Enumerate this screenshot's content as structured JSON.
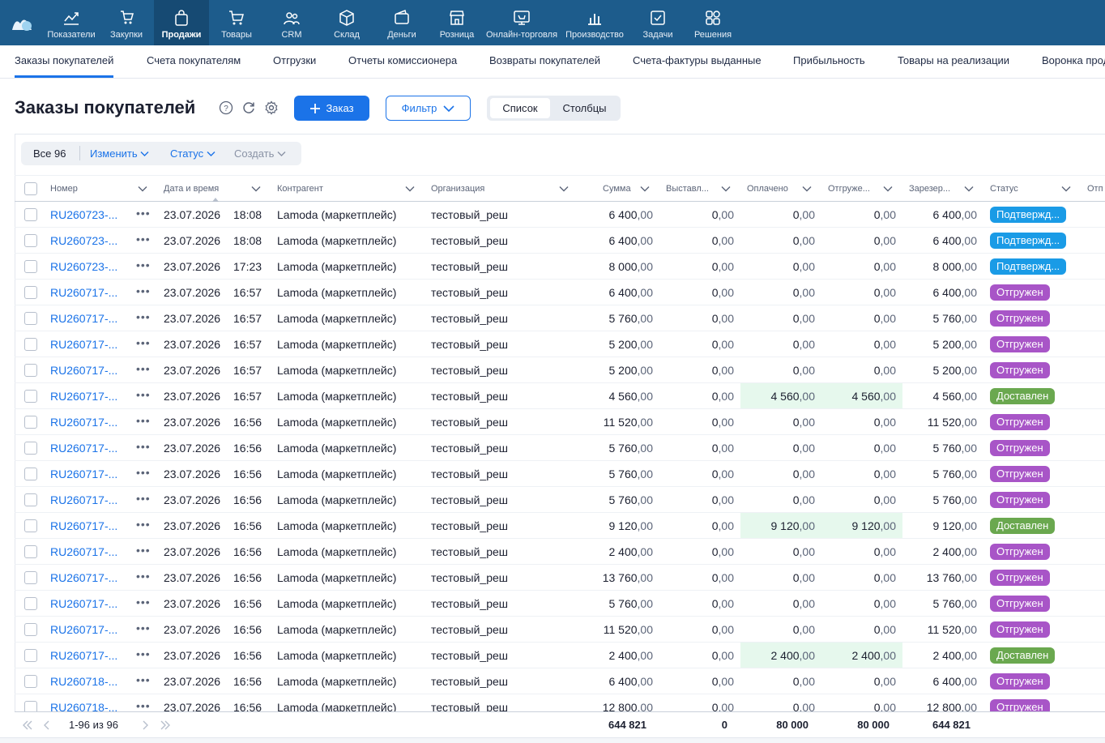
{
  "topnav": {
    "items": [
      {
        "label": "Показатели",
        "icon": "chart-line-icon"
      },
      {
        "label": "Закупки",
        "icon": "cart-hand-icon"
      },
      {
        "label": "Продажи",
        "icon": "shopping-bag-icon",
        "active": true
      },
      {
        "label": "Товары",
        "icon": "cart-icon"
      },
      {
        "label": "CRM",
        "icon": "users-icon"
      },
      {
        "label": "Склад",
        "icon": "box-icon"
      },
      {
        "label": "Деньги",
        "icon": "wallet-icon"
      },
      {
        "label": "Розница",
        "icon": "store-icon"
      },
      {
        "label": "Онлайн-торговля",
        "icon": "online-store-icon"
      },
      {
        "label": "Производство",
        "icon": "bar-chart-icon"
      },
      {
        "label": "Задачи",
        "icon": "check-icon"
      },
      {
        "label": "Решения",
        "icon": "grid-icon"
      }
    ]
  },
  "subnav": {
    "items": [
      "Заказы покупателей",
      "Счета покупателям",
      "Отгрузки",
      "Отчеты комиссионера",
      "Возвраты покупателей",
      "Счета-фактуры выданные",
      "Прибыльность",
      "Товары на реализации",
      "Воронка продаж"
    ]
  },
  "page": {
    "title": "Заказы покупателей",
    "add_button": "Заказ",
    "filter_button": "Фильтр",
    "view_list": "Список",
    "view_columns": "Столбцы"
  },
  "toolbar": {
    "all": "Все 96",
    "edit": "Изменить",
    "status": "Статус",
    "create": "Создать"
  },
  "table": {
    "headers": {
      "number": "Номер",
      "datetime": "Дата и время",
      "counterparty": "Контрагент",
      "organization": "Организация",
      "sum": "Сумма",
      "invoiced": "Выставл...",
      "paid": "Оплачено",
      "shipped": "Отгруже...",
      "reserved": "Зарезер...",
      "status": "Статус",
      "extra": "Отп"
    },
    "rows": [
      {
        "number": "RU260723-...",
        "date": "23.07.2026",
        "time": "18:08",
        "counterparty": "Lamoda (маркетплейс)",
        "org": "тестовый_реш",
        "sum": "6 400",
        "invoiced": "0",
        "paid": "0",
        "shipped": "0",
        "reserved": "6 400",
        "status": "Подтвержд...",
        "status_color": "#1a9be6",
        "highlight": false
      },
      {
        "number": "RU260723-...",
        "date": "23.07.2026",
        "time": "18:08",
        "counterparty": "Lamoda (маркетплейс)",
        "org": "тестовый_реш",
        "sum": "6 400",
        "invoiced": "0",
        "paid": "0",
        "shipped": "0",
        "reserved": "6 400",
        "status": "Подтвержд...",
        "status_color": "#1a9be6",
        "highlight": false
      },
      {
        "number": "RU260723-...",
        "date": "23.07.2026",
        "time": "17:23",
        "counterparty": "Lamoda (маркетплейс)",
        "org": "тестовый_реш",
        "sum": "8 000",
        "invoiced": "0",
        "paid": "0",
        "shipped": "0",
        "reserved": "8 000",
        "status": "Подтвержд...",
        "status_color": "#1a9be6",
        "highlight": false
      },
      {
        "number": "RU260717-...",
        "date": "23.07.2026",
        "time": "16:57",
        "counterparty": "Lamoda (маркетплейс)",
        "org": "тестовый_реш",
        "sum": "6 400",
        "invoiced": "0",
        "paid": "0",
        "shipped": "0",
        "reserved": "6 400",
        "status": "Отгружен",
        "status_color": "#a855c7",
        "highlight": false
      },
      {
        "number": "RU260717-...",
        "date": "23.07.2026",
        "time": "16:57",
        "counterparty": "Lamoda (маркетплейс)",
        "org": "тестовый_реш",
        "sum": "5 760",
        "invoiced": "0",
        "paid": "0",
        "shipped": "0",
        "reserved": "5 760",
        "status": "Отгружен",
        "status_color": "#a855c7",
        "highlight": false
      },
      {
        "number": "RU260717-...",
        "date": "23.07.2026",
        "time": "16:57",
        "counterparty": "Lamoda (маркетплейс)",
        "org": "тестовый_реш",
        "sum": "5 200",
        "invoiced": "0",
        "paid": "0",
        "shipped": "0",
        "reserved": "5 200",
        "status": "Отгружен",
        "status_color": "#a855c7",
        "highlight": false
      },
      {
        "number": "RU260717-...",
        "date": "23.07.2026",
        "time": "16:57",
        "counterparty": "Lamoda (маркетплейс)",
        "org": "тестовый_реш",
        "sum": "5 200",
        "invoiced": "0",
        "paid": "0",
        "shipped": "0",
        "reserved": "5 200",
        "status": "Отгружен",
        "status_color": "#a855c7",
        "highlight": false
      },
      {
        "number": "RU260717-...",
        "date": "23.07.2026",
        "time": "16:57",
        "counterparty": "Lamoda (маркетплейс)",
        "org": "тестовый_реш",
        "sum": "4 560",
        "invoiced": "0",
        "paid": "4 560",
        "shipped": "4 560",
        "reserved": "4 560",
        "status": "Доставлен",
        "status_color": "#6aa84f",
        "highlight": true
      },
      {
        "number": "RU260717-...",
        "date": "23.07.2026",
        "time": "16:56",
        "counterparty": "Lamoda (маркетплейс)",
        "org": "тестовый_реш",
        "sum": "11 520",
        "invoiced": "0",
        "paid": "0",
        "shipped": "0",
        "reserved": "11 520",
        "status": "Отгружен",
        "status_color": "#a855c7",
        "highlight": false
      },
      {
        "number": "RU260717-...",
        "date": "23.07.2026",
        "time": "16:56",
        "counterparty": "Lamoda (маркетплейс)",
        "org": "тестовый_реш",
        "sum": "5 760",
        "invoiced": "0",
        "paid": "0",
        "shipped": "0",
        "reserved": "5 760",
        "status": "Отгружен",
        "status_color": "#a855c7",
        "highlight": false
      },
      {
        "number": "RU260717-...",
        "date": "23.07.2026",
        "time": "16:56",
        "counterparty": "Lamoda (маркетплейс)",
        "org": "тестовый_реш",
        "sum": "5 760",
        "invoiced": "0",
        "paid": "0",
        "shipped": "0",
        "reserved": "5 760",
        "status": "Отгружен",
        "status_color": "#a855c7",
        "highlight": false
      },
      {
        "number": "RU260717-...",
        "date": "23.07.2026",
        "time": "16:56",
        "counterparty": "Lamoda (маркетплейс)",
        "org": "тестовый_реш",
        "sum": "5 760",
        "invoiced": "0",
        "paid": "0",
        "shipped": "0",
        "reserved": "5 760",
        "status": "Отгружен",
        "status_color": "#a855c7",
        "highlight": false
      },
      {
        "number": "RU260717-...",
        "date": "23.07.2026",
        "time": "16:56",
        "counterparty": "Lamoda (маркетплейс)",
        "org": "тестовый_реш",
        "sum": "9 120",
        "invoiced": "0",
        "paid": "9 120",
        "shipped": "9 120",
        "reserved": "9 120",
        "status": "Доставлен",
        "status_color": "#6aa84f",
        "highlight": true
      },
      {
        "number": "RU260717-...",
        "date": "23.07.2026",
        "time": "16:56",
        "counterparty": "Lamoda (маркетплейс)",
        "org": "тестовый_реш",
        "sum": "2 400",
        "invoiced": "0",
        "paid": "0",
        "shipped": "0",
        "reserved": "2 400",
        "status": "Отгружен",
        "status_color": "#a855c7",
        "highlight": false
      },
      {
        "number": "RU260717-...",
        "date": "23.07.2026",
        "time": "16:56",
        "counterparty": "Lamoda (маркетплейс)",
        "org": "тестовый_реш",
        "sum": "13 760",
        "invoiced": "0",
        "paid": "0",
        "shipped": "0",
        "reserved": "13 760",
        "status": "Отгружен",
        "status_color": "#a855c7",
        "highlight": false
      },
      {
        "number": "RU260717-...",
        "date": "23.07.2026",
        "time": "16:56",
        "counterparty": "Lamoda (маркетплейс)",
        "org": "тестовый_реш",
        "sum": "5 760",
        "invoiced": "0",
        "paid": "0",
        "shipped": "0",
        "reserved": "5 760",
        "status": "Отгружен",
        "status_color": "#a855c7",
        "highlight": false
      },
      {
        "number": "RU260717-...",
        "date": "23.07.2026",
        "time": "16:56",
        "counterparty": "Lamoda (маркетплейс)",
        "org": "тестовый_реш",
        "sum": "11 520",
        "invoiced": "0",
        "paid": "0",
        "shipped": "0",
        "reserved": "11 520",
        "status": "Отгружен",
        "status_color": "#a855c7",
        "highlight": false
      },
      {
        "number": "RU260717-...",
        "date": "23.07.2026",
        "time": "16:56",
        "counterparty": "Lamoda (маркетплейс)",
        "org": "тестовый_реш",
        "sum": "2 400",
        "invoiced": "0",
        "paid": "2 400",
        "shipped": "2 400",
        "reserved": "2 400",
        "status": "Доставлен",
        "status_color": "#6aa84f",
        "highlight": true
      },
      {
        "number": "RU260718-...",
        "date": "23.07.2026",
        "time": "16:56",
        "counterparty": "Lamoda (маркетплейс)",
        "org": "тестовый_реш",
        "sum": "6 400",
        "invoiced": "0",
        "paid": "0",
        "shipped": "0",
        "reserved": "6 400",
        "status": "Отгружен",
        "status_color": "#a855c7",
        "highlight": false
      },
      {
        "number": "RU260718-...",
        "date": "23.07.2026",
        "time": "16:56",
        "counterparty": "Lamoda (маркетплейс)",
        "org": "тестовый_реш",
        "sum": "12 800",
        "invoiced": "0",
        "paid": "0",
        "shipped": "0",
        "reserved": "12 800",
        "status": "Отгружен",
        "status_color": "#a855c7",
        "highlight": false
      }
    ],
    "decimal_suffix": ",00"
  },
  "footer": {
    "range": "1-96 из 96",
    "total_sum": "644 821",
    "total_invoiced": "0",
    "total_paid": "80 000",
    "total_shipped": "80 000",
    "total_reserved": "644 821"
  }
}
